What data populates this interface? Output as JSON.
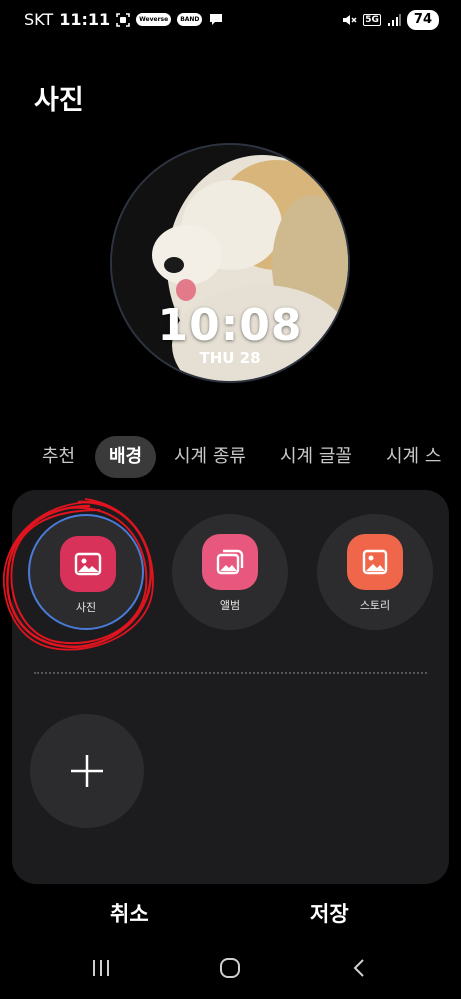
{
  "status_bar": {
    "carrier": "SKT",
    "time": "11:11",
    "pill_1": "Weverse",
    "pill_2": "BAND",
    "network": "5G",
    "battery": "74"
  },
  "page_title": "사진",
  "watch": {
    "time": "10:08",
    "date": "THU 28"
  },
  "tabs": [
    {
      "label": "추천"
    },
    {
      "label": "배경",
      "active": true
    },
    {
      "label": "시계 종류"
    },
    {
      "label": "시계 글꼴"
    },
    {
      "label": "시계 스"
    }
  ],
  "sources": [
    {
      "label": "사진",
      "color": "#d9325a",
      "selected": true
    },
    {
      "label": "앨범",
      "color": "#e8577d"
    },
    {
      "label": "스토리",
      "color": "#f0664a"
    }
  ],
  "actions": {
    "cancel": "취소",
    "save": "저장"
  },
  "icons": {
    "recent_apps": "recent-apps-icon",
    "home": "home-icon",
    "back": "back-icon"
  },
  "annotation_color": "#e0141e"
}
